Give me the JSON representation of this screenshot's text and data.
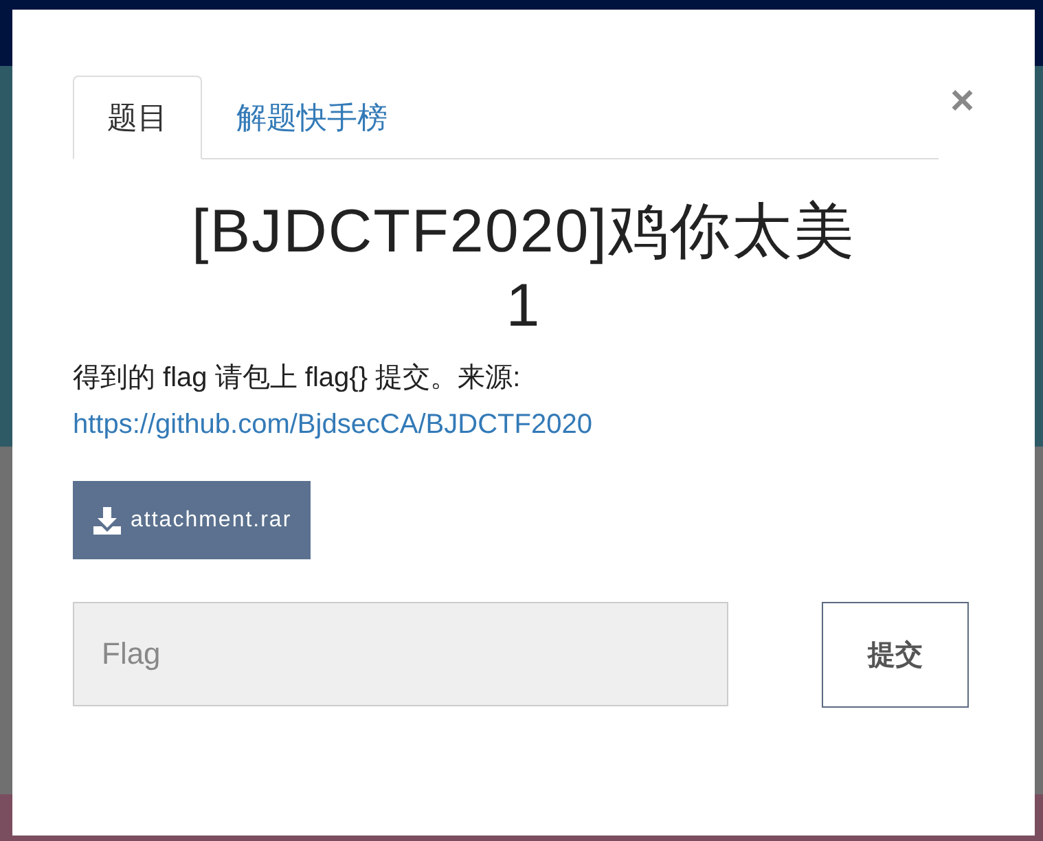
{
  "tabs": [
    {
      "label": "题目",
      "selected": true
    },
    {
      "label": "解题快手榜",
      "selected": false
    }
  ],
  "close": "×",
  "title": "[BJDCTF2020]鸡你太美 1",
  "description": "得到的 flag 请包上 flag{} 提交。来源:",
  "source_link": "https://github.com/BjdsecCA/BJDCTF2020",
  "attachment": "attachment.rar",
  "flag_field": {
    "placeholder": "Flag"
  },
  "submit": "提交"
}
